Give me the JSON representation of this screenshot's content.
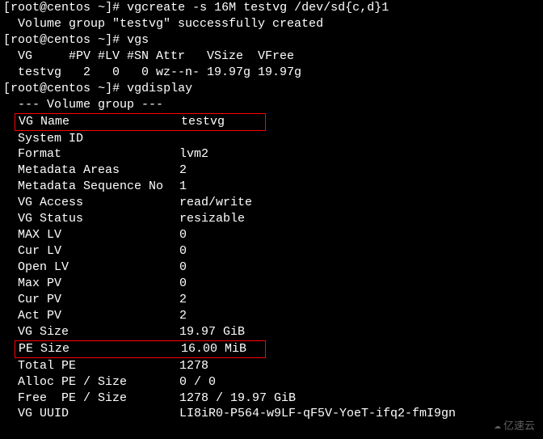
{
  "prompt": {
    "user": "root",
    "host": "centos",
    "path": "~",
    "symbol": "#"
  },
  "commands": {
    "vgcreate": "vgcreate -s 16M testvg /dev/sd{c,d}1",
    "vgs": "vgs",
    "vgdisplay": "vgdisplay"
  },
  "output": {
    "vgcreate_msg": "  Volume group \"testvg\" successfully created",
    "vgs_header": "  VG     #PV #LV #SN Attr   VSize  VFree",
    "vgs_row": "  testvg   2   0   0 wz--n- 19.97g 19.97g",
    "vgdisplay_header": "  --- Volume group ---"
  },
  "vgdisplay": {
    "vg_name": {
      "label": "VG Name",
      "value": "testvg"
    },
    "system_id": {
      "label": "System ID",
      "value": ""
    },
    "format": {
      "label": "Format",
      "value": "lvm2"
    },
    "metadata_areas": {
      "label": "Metadata Areas",
      "value": "2"
    },
    "metadata_seq": {
      "label": "Metadata Sequence No",
      "value": "1"
    },
    "vg_access": {
      "label": "VG Access",
      "value": "read/write"
    },
    "vg_status": {
      "label": "VG Status",
      "value": "resizable"
    },
    "max_lv": {
      "label": "MAX LV",
      "value": "0"
    },
    "cur_lv": {
      "label": "Cur LV",
      "value": "0"
    },
    "open_lv": {
      "label": "Open LV",
      "value": "0"
    },
    "max_pv": {
      "label": "Max PV",
      "value": "0"
    },
    "cur_pv": {
      "label": "Cur PV",
      "value": "2"
    },
    "act_pv": {
      "label": "Act PV",
      "value": "2"
    },
    "vg_size": {
      "label": "VG Size",
      "value": "19.97 GiB"
    },
    "pe_size": {
      "label": "PE Size",
      "value": "16.00 MiB"
    },
    "total_pe": {
      "label": "Total PE",
      "value": "1278"
    },
    "alloc_pe": {
      "label": "Alloc PE / Size",
      "value": "0 / 0"
    },
    "free_pe": {
      "label": "Free  PE / Size",
      "value": "1278 / 19.97 GiB"
    },
    "vg_uuid": {
      "label": "VG UUID",
      "value": "LI8iR0-P564-w9LF-qF5V-YoeT-ifq2-fmI9gn"
    }
  },
  "watermark": "亿速云"
}
